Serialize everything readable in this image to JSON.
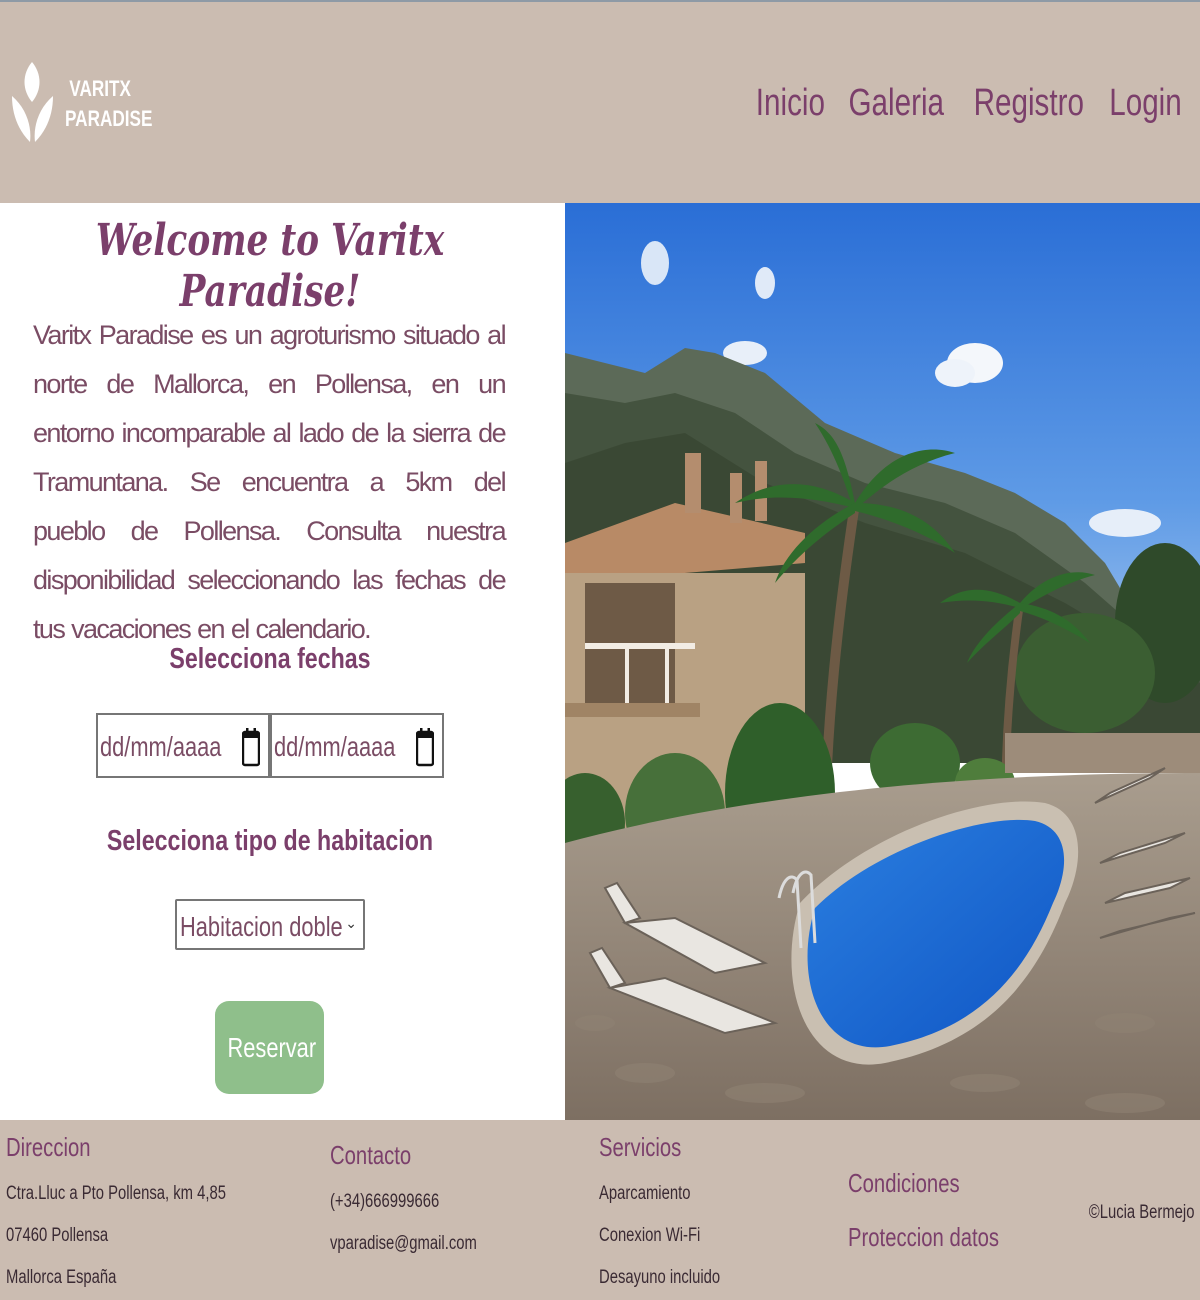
{
  "brand": {
    "line1": "VARITX",
    "line2": "PARADISE"
  },
  "nav": {
    "items": [
      {
        "label": "Inicio"
      },
      {
        "label": "Galeria"
      },
      {
        "label": "Registro"
      },
      {
        "label": "Login"
      }
    ]
  },
  "main": {
    "title": "Welcome to Varitx Paradise!",
    "intro": "Varitx Paradise es un agroturismo situado al norte de Mallorca, en Pollensa, en un entorno incomparable al lado de la sierra de Tramuntana. Se encuentra a 5km del pueblo de Pollensa. Consulta nuestra disponibilidad seleccionando las fechas de tus vacaciones en el calendario.",
    "dates_title": "Selecciona fechas",
    "date_start_placeholder": "dd/mm/aaaa",
    "date_end_placeholder": "dd/mm/aaaa",
    "room_title": "Selecciona tipo de habitacion",
    "room_selected": "Habitacion doble",
    "reserve_label": "Reservar"
  },
  "footer": {
    "address": {
      "heading": "Direccion",
      "lines": [
        "Ctra.Lluc a Pto Pollensa, km 4,85",
        "07460 Pollensa",
        "Mallorca España"
      ]
    },
    "contact": {
      "heading": "Contacto",
      "lines": [
        "(+34)666999666",
        "vparadise@gmail.com"
      ]
    },
    "services": {
      "heading": "Servicios",
      "lines": [
        "Aparcamiento",
        "Conexion Wi-Fi",
        "Desayuno incluido"
      ]
    },
    "legal": {
      "conditions": "Condiciones",
      "privacy": "Proteccion datos"
    },
    "copyright": "©Lucia Bermejo"
  },
  "colors": {
    "header_bg": "#cbbcb1",
    "accent": "#7b3f6b",
    "button": "#8fbf8b"
  }
}
